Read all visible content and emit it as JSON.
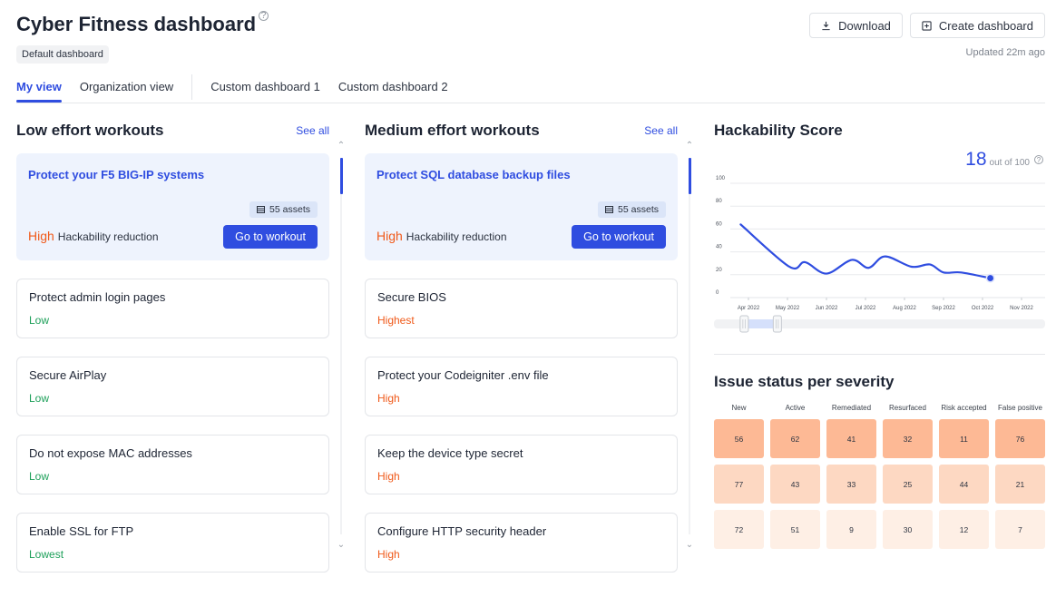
{
  "header": {
    "title": "Cyber Fitness dashboard",
    "help_icon": "?",
    "badge": "Default dashboard",
    "download_label": "Download",
    "create_label": "Create dashboard",
    "updated": "Updated 22m ago"
  },
  "tabs": [
    {
      "label": "My view",
      "active": true
    },
    {
      "label": "Organization view",
      "active": false
    },
    {
      "label": "Custom dashboard 1",
      "active": false
    },
    {
      "label": "Custom dashboard 2",
      "active": false
    }
  ],
  "colors": {
    "accent": "#2f4de0",
    "high": "#f05a1a",
    "low": "#1ea05a",
    "heat_row_1": "#fdb995",
    "heat_row_2": "#fdd8c2",
    "heat_row_3": "#feefe5"
  },
  "low_effort": {
    "title": "Low effort workouts",
    "see_all": "See all",
    "featured": {
      "title": "Protect your F5 BIG-IP systems",
      "assets": "55 assets",
      "level": "High",
      "reduction_label": "Hackability reduction",
      "button": "Go to workout"
    },
    "items": [
      {
        "title": "Protect admin login pages",
        "level": "Low",
        "tone": "low"
      },
      {
        "title": "Secure AirPlay",
        "level": "Low",
        "tone": "low"
      },
      {
        "title": "Do not expose MAC addresses",
        "level": "Low",
        "tone": "low"
      },
      {
        "title": "Enable SSL for FTP",
        "level": "Lowest",
        "tone": "low"
      }
    ]
  },
  "medium_effort": {
    "title": "Medium effort workouts",
    "see_all": "See all",
    "featured": {
      "title": "Protect SQL database backup files",
      "assets": "55 assets",
      "level": "High",
      "reduction_label": "Hackability reduction",
      "button": "Go to workout"
    },
    "items": [
      {
        "title": "Secure BIOS",
        "level": "Highest",
        "tone": "high"
      },
      {
        "title": "Protect your Codeigniter .env file",
        "level": "High",
        "tone": "high"
      },
      {
        "title": "Keep the device type secret",
        "level": "High",
        "tone": "high"
      },
      {
        "title": "Configure HTTP security header",
        "level": "High",
        "tone": "high"
      }
    ]
  },
  "hackability": {
    "title": "Hackability Score",
    "score": "18",
    "out_of": "out of 100"
  },
  "issues": {
    "title": "Issue status per severity",
    "columns": [
      "New",
      "Active",
      "Remediated",
      "Resurfaced",
      "Risk accepted",
      "False positive"
    ],
    "rows": [
      [
        56,
        62,
        41,
        32,
        11,
        76
      ],
      [
        77,
        43,
        33,
        25,
        44,
        21
      ],
      [
        72,
        51,
        9,
        30,
        12,
        7
      ]
    ]
  },
  "chart_data": [
    {
      "type": "line",
      "title": "Hackability Score",
      "xlabel": "",
      "ylabel": "",
      "ylim": [
        0,
        100
      ],
      "yticks": [
        0,
        20,
        40,
        60,
        80,
        100
      ],
      "xticks": [
        "Apr 2022",
        "May 2022",
        "Jun 2022",
        "Jul 2022",
        "Aug 2022",
        "Sep 2022",
        "Oct 2022",
        "Nov 2022"
      ],
      "grid": true,
      "series": [
        {
          "name": "Hackability Score",
          "x_months": [
            -0.2,
            1.05,
            1.45,
            2.0,
            2.65,
            3.08,
            3.5,
            4.18,
            4.65,
            5.0,
            5.45,
            6.2
          ],
          "values": [
            64,
            27,
            31,
            21,
            33,
            26,
            36,
            27,
            29,
            22,
            22,
            17
          ]
        }
      ],
      "range_selector": {
        "start_fraction": 0.09,
        "end_fraction": 0.19
      }
    },
    {
      "type": "heatmap",
      "title": "Issue status per severity",
      "columns": [
        "New",
        "Active",
        "Remediated",
        "Resurfaced",
        "Risk accepted",
        "False positive"
      ],
      "rows": [
        [
          56,
          62,
          41,
          32,
          11,
          76
        ],
        [
          77,
          43,
          33,
          25,
          44,
          21
        ],
        [
          72,
          51,
          9,
          30,
          12,
          7
        ]
      ]
    }
  ]
}
